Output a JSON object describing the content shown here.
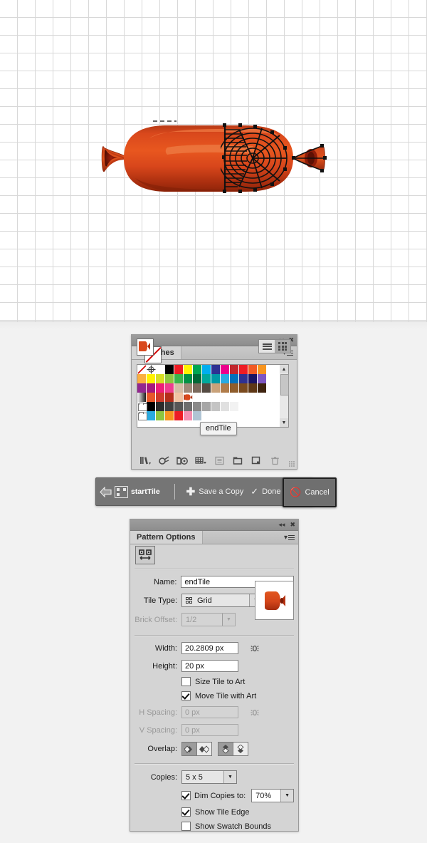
{
  "canvas": {
    "artwork_name": "salami-sausage-pattern-tile",
    "grid_spacing_px": 25,
    "colors": {
      "grid_line": "#d8d8d8",
      "background": "#ffffff",
      "salami_light": "#e8571f",
      "salami_mid": "#d6401a",
      "salami_dark": "#9e2b10",
      "salami_highlight": "#f07a40"
    }
  },
  "swatches_panel": {
    "title": "Swatches",
    "titlebar": {
      "collapse_icon": "collapse-to-icons",
      "close_icon": "close"
    },
    "menu_icon": "panel-menu-icon",
    "view_modes": [
      {
        "name": "list-view",
        "selected": false
      },
      {
        "name": "grid-view",
        "selected": true
      }
    ],
    "fill_stroke": {
      "fill": "pattern-endTile",
      "stroke": "none"
    },
    "tooltip": "endTile",
    "rows": [
      [
        "none",
        "registration",
        "#ffffff",
        "#000000",
        "#ed1c24",
        "#fff200",
        "#00a651",
        "#00aeef",
        "#2e3192",
        "#ec008c",
        "#c1272d",
        "#ed1c24",
        "#f15a24",
        "#f7941e"
      ],
      [
        "#fbb040",
        "#fff200",
        "#d7df23",
        "#8dc63f",
        "#39b54a",
        "#009245",
        "#006837",
        "#00a99d",
        "#0099a6",
        "#29abe2",
        "#0071bc",
        "#2e3192",
        "#1b1464",
        "#7e57c2"
      ],
      [
        "#92278f",
        "#a5197e",
        "#ed1e79",
        "#ee3d8f",
        "#d6bca6",
        "#a08a7a",
        "#7a6a5d",
        "#554b43",
        "#c9a27a",
        "#b07c4a",
        "#8f5d2c",
        "#7a4a1e",
        "#5e3715",
        "#3f2410"
      ],
      [
        "gradient",
        "#e8572a",
        "#cf3a2a",
        "#b52e1b",
        "#f0c3a4",
        "pattern-endTile",
        "#ffffff",
        "#ffffff",
        "#ffffff",
        "#ffffff",
        "#ffffff",
        "#ffffff",
        "#ffffff",
        "#ffffff"
      ],
      [
        "folder",
        "#000000",
        "#2b2b2b",
        "#3f3f3f",
        "#565656",
        "#6e6e6e",
        "#8a8a8a",
        "#a6a6a6",
        "#c4c4c4",
        "#e0e0e0",
        "#f2f2f2",
        "#ffffff",
        "#ffffff",
        "#ffffff"
      ],
      [
        "folder",
        "#29abe2",
        "#8dc63f",
        "#f7941e",
        "#ed1c24",
        "#f48fb1",
        "#b0c4d4",
        "#ffffff",
        "#ffffff",
        "#ffffff",
        "#ffffff",
        "#ffffff",
        "#ffffff",
        "#ffffff"
      ]
    ],
    "footer_buttons": [
      {
        "name": "swatch-libraries-menu",
        "icon": "library-icon",
        "enabled": true
      },
      {
        "name": "show-swatch-kinds-menu",
        "icon": "link-swatch-icon",
        "enabled": true
      },
      {
        "name": "swatch-options",
        "icon": "color-group-icon",
        "enabled": true
      },
      {
        "name": "show-swatch-kinds",
        "icon": "grid-kinds-icon",
        "enabled": true
      },
      {
        "name": "swatch-options-dialog",
        "icon": "options-icon",
        "enabled": false
      },
      {
        "name": "new-color-group",
        "icon": "folder-icon",
        "enabled": true
      },
      {
        "name": "new-swatch",
        "icon": "new-swatch-icon",
        "enabled": true
      },
      {
        "name": "delete-swatch",
        "icon": "trash-icon",
        "enabled": false
      }
    ]
  },
  "control_bar": {
    "back_icon": "back-arrow-icon",
    "tile_icon": "pattern-tile-icon",
    "tile_name": "startTile",
    "save_copy_label": "Save a Copy",
    "save_copy_icon": "plus-icon",
    "done_label": "Done",
    "done_icon": "check-icon",
    "cancel_label": "Cancel",
    "cancel_icon": "cancel-icon"
  },
  "pattern_options": {
    "title": "Pattern Options",
    "titlebar": {
      "collapse_icon": "collapse-to-icons",
      "close_icon": "close"
    },
    "menu_icon": "panel-menu-icon",
    "tile_edit_button": "pattern-tile-tool-icon",
    "name": {
      "label": "Name:",
      "value": "endTile"
    },
    "tile_type": {
      "label": "Tile Type:",
      "value": "Grid",
      "icon": "grid-icon"
    },
    "brick_offset": {
      "label": "Brick Offset:",
      "value": "1/2",
      "enabled": false
    },
    "preview_thumbnail": "pattern-tile-thumbnail",
    "width": {
      "label": "Width:",
      "value": "20.2809 px"
    },
    "height": {
      "label": "Height:",
      "value": "20 px"
    },
    "size_link_icon": "link-dimensions-icon",
    "size_tile_to_art": {
      "label": "Size Tile to Art",
      "checked": false
    },
    "move_tile_with_art": {
      "label": "Move Tile with Art",
      "checked": true
    },
    "h_spacing": {
      "label": "H Spacing:",
      "value": "0 px",
      "enabled": false
    },
    "v_spacing": {
      "label": "V Spacing:",
      "value": "0 px",
      "enabled": false
    },
    "spacing_link_icon": "link-spacing-icon",
    "overlap": {
      "label": "Overlap:",
      "buttons": [
        {
          "name": "overlap-left-in-front",
          "selected": true
        },
        {
          "name": "overlap-right-in-front",
          "selected": false
        },
        {
          "name": "overlap-bottom-in-front",
          "selected": true
        },
        {
          "name": "overlap-top-in-front",
          "selected": false
        }
      ]
    },
    "copies": {
      "label": "Copies:",
      "value": "5 x 5"
    },
    "dim_copies": {
      "label": "Dim Copies to:",
      "checked": true,
      "value": "70%"
    },
    "show_tile_edge": {
      "label": "Show Tile Edge",
      "checked": true
    },
    "show_swatch_bounds": {
      "label": "Show Swatch Bounds",
      "checked": false
    }
  }
}
